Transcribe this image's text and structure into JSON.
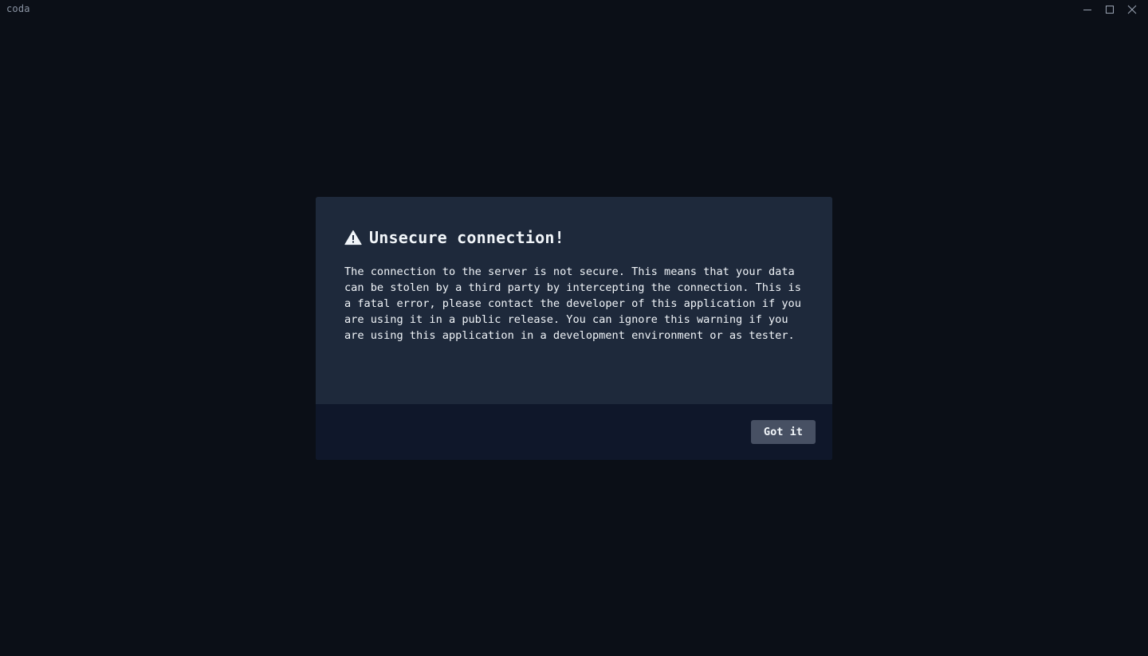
{
  "window": {
    "title": "coda",
    "controls": [
      {
        "name": "minimize-icon"
      },
      {
        "name": "maximize-icon"
      },
      {
        "name": "close-icon"
      }
    ]
  },
  "dialog": {
    "icon": "warning-icon",
    "title": "Unsecure connection!",
    "message": "The connection to the server is not secure. This means that your data can be stolen by a third party by intercepting the connection. This is a fatal error, please contact the developer of this application if you are using it in a public release. You can ignore this warning if you are using this application in a development environment or as tester.",
    "confirm_label": "Got it"
  },
  "colors": {
    "background": "#0b0f17",
    "dialog_body": "#1e293b",
    "dialog_footer": "#0f172a",
    "button": "#475063",
    "text": "#f1f5f9"
  }
}
